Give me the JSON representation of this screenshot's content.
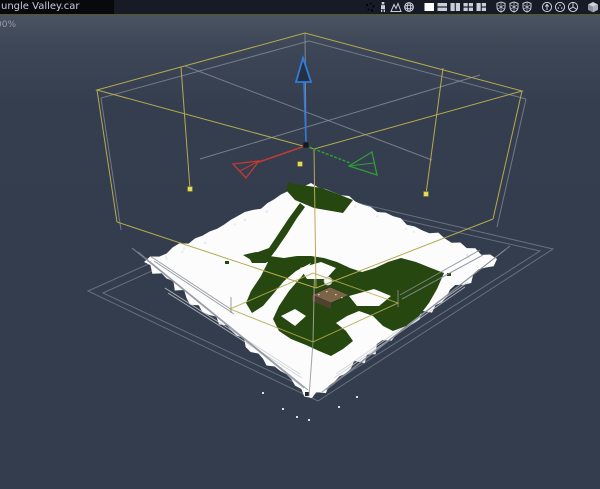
{
  "tab": {
    "title": "ungle Valley.car"
  },
  "viewport": {
    "zoom_label": "00%"
  },
  "toolbar": {
    "groups": [
      [
        {
          "name": "particles-icon",
          "icon": "particles"
        },
        {
          "name": "puppet-icon",
          "icon": "puppet"
        },
        {
          "name": "terrain-icon",
          "icon": "mountains"
        },
        {
          "name": "cage-sphere-icon",
          "icon": "cage"
        }
      ],
      [
        {
          "name": "layout-single-icon",
          "icon": "layout-single",
          "active": true
        },
        {
          "name": "layout-rows-icon",
          "icon": "layout-rows"
        },
        {
          "name": "layout-columns-icon",
          "icon": "layout-columns"
        },
        {
          "name": "layout-grid-icon",
          "icon": "layout-grid"
        },
        {
          "name": "layout-mixed-icon",
          "icon": "layout-mixed"
        }
      ],
      [
        {
          "name": "shield-wire-icon",
          "icon": "shield"
        },
        {
          "name": "shield-mesh-icon",
          "icon": "shield"
        },
        {
          "name": "shield-grid-icon",
          "icon": "shield"
        }
      ],
      [
        {
          "name": "orb-arrow-icon",
          "icon": "orb-arrow"
        },
        {
          "name": "orb-mesh-icon",
          "icon": "orb-mesh"
        },
        {
          "name": "orb-wheel-icon",
          "icon": "orb-wheel"
        }
      ],
      [
        {
          "name": "cube-icon",
          "icon": "cube"
        }
      ]
    ]
  },
  "scene": {
    "colors": {
      "selection_wire": "#b4ab4f",
      "reference_wire": "#878d96",
      "grid_wire": "#9aa0a8",
      "handle_fill": "#e3d95f",
      "axis_x": "#c23a33",
      "axis_y": "#2f9e38",
      "axis_z": "#2e7ce0",
      "terrain_ground": "#fcfcfd",
      "terrain_vegetation": "#26470f",
      "icon_color": "#c9cfd9"
    }
  }
}
